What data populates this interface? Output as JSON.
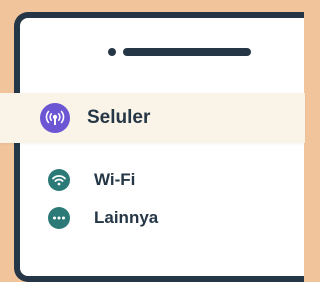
{
  "menu": {
    "selected": {
      "label": "Seluler",
      "icon": "cellular-signal-icon",
      "icon_color": "#6c56d4"
    },
    "items": [
      {
        "label": "Wi-Fi",
        "icon": "wifi-icon",
        "icon_color": "#2b7a78"
      },
      {
        "label": "Lainnya",
        "icon": "more-icon",
        "icon_color": "#2b7a78"
      }
    ]
  },
  "colors": {
    "background": "#f2c49b",
    "phone_frame": "#253746",
    "highlight_bg": "#faf3e7"
  }
}
